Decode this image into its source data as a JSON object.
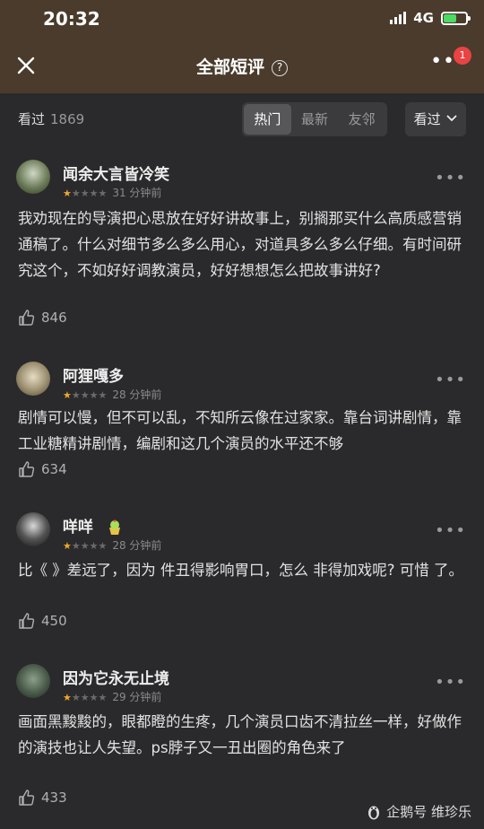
{
  "status": {
    "time": "20:32",
    "network": "4G"
  },
  "nav": {
    "title": "全部短评",
    "help_glyph": "?",
    "badge": "1"
  },
  "filter": {
    "seen_label": "看过",
    "seen_count": "1869",
    "tabs": [
      "热门",
      "最新",
      "友邻"
    ],
    "active_tab": "热门",
    "seen_filter": "看过"
  },
  "reviews": [
    {
      "user": "闻余大言皆冷笑",
      "rating": 1,
      "time": "31 分钟前",
      "text": "我劝现在的导演把心思放在好好讲故事上，别搁那买什么高质感营销通稿了。什么对细节多么多么用心，对道具多么多么仔细。有时间研究这个，不如好好调教演员，好好想想怎么把故事讲好?",
      "likes": "846"
    },
    {
      "user": "阿狸嘎多",
      "rating": 1,
      "time": "28 分钟前",
      "text": "剧情可以慢，但不可以乱，不知所云像在过家家。靠台词讲剧情，靠工业糖精讲剧情，编剧和这几个演员的水平还不够",
      "likes": "634"
    },
    {
      "user": "咩咩",
      "rating": 1,
      "time": "28 分钟前",
      "text": "比《 》差远了，因为 件丑得影响胃口，怎么 非得加戏呢? 可惜 了。",
      "likes": "450"
    },
    {
      "user": "因为它永无止境",
      "rating": 1,
      "time": "29 分钟前",
      "text": "画面黑黢黢的，眼都瞪的生疼，几个演员口齿不清拉丝一样，好做作的演技也让人失望。ps脖子又一丑出圈的角色来了",
      "likes": "433"
    }
  ],
  "watermark": "企鹅号 维珍乐",
  "colors": {
    "header_bg": "#4a3b2c",
    "body_bg": "#2a2a2c",
    "star": "#f0a72c",
    "badge": "#e94343"
  }
}
